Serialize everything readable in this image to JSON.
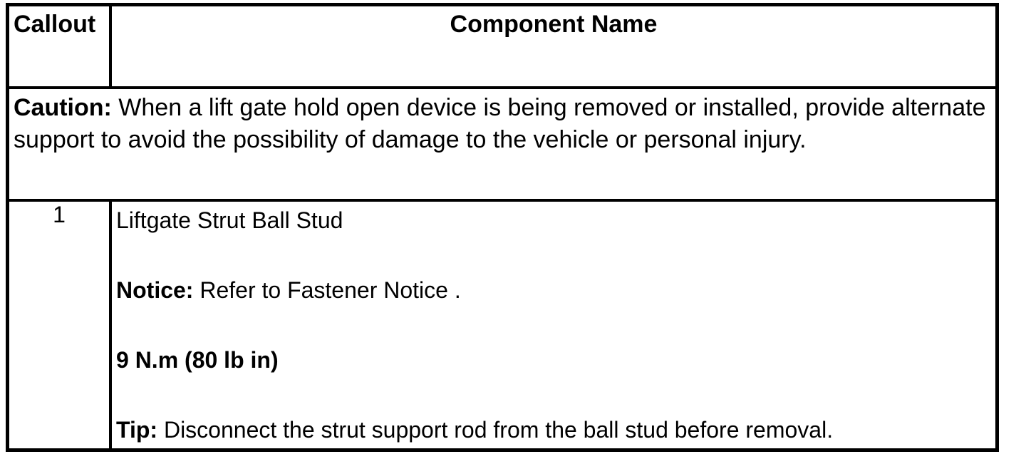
{
  "table": {
    "headers": {
      "callout": "Callout",
      "component_name": "Component Name"
    },
    "caution": {
      "label": "Caution:",
      "text": " When a lift gate hold open device is being removed or installed, provide alternate support to avoid the possibility of damage to the vehicle or personal injury."
    },
    "rows": [
      {
        "callout": "1",
        "component": "Liftgate Strut Ball Stud",
        "notice_label": "Notice:",
        "notice_text": " Refer to Fastener Notice .",
        "torque": "9 N.m (80 lb in)",
        "tip_label": "Tip:",
        "tip_text": " Disconnect the strut support rod from the ball stud before removal."
      }
    ]
  }
}
